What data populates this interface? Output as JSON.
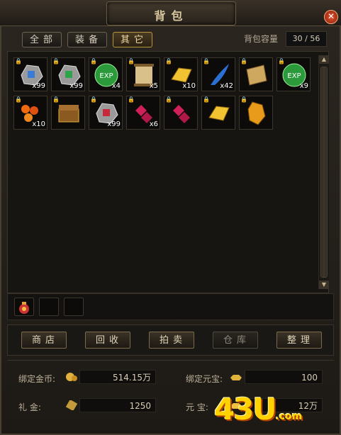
{
  "window": {
    "title": "背包",
    "close_icon": "close-icon"
  },
  "tabs": [
    {
      "label": "全部",
      "active": false
    },
    {
      "label": "装备",
      "active": false
    },
    {
      "label": "其它",
      "active": true
    }
  ],
  "capacity": {
    "label": "背包容量",
    "value": "30 / 56"
  },
  "items": [
    {
      "icon": "blue-rune-stone-icon",
      "count": "x99"
    },
    {
      "icon": "green-rune-stone-icon",
      "count": "x99"
    },
    {
      "icon": "green-exp-orb-icon",
      "count": "x4",
      "text": "EXP"
    },
    {
      "icon": "scroll-icon",
      "count": "x5"
    },
    {
      "icon": "gold-bar-icon",
      "count": "x10"
    },
    {
      "icon": "blue-feather-icon",
      "count": "x42"
    },
    {
      "icon": "parchment-icon",
      "count": ""
    },
    {
      "icon": "green-exp-orb-icon",
      "count": "x9",
      "text": "EXP"
    },
    {
      "icon": "fire-orbs-icon",
      "count": "x10"
    },
    {
      "icon": "treasure-chest-icon",
      "count": ""
    },
    {
      "icon": "red-rune-stone-icon",
      "count": "x99"
    },
    {
      "icon": "red-gems-icon",
      "count": "x6"
    },
    {
      "icon": "red-gems-icon",
      "count": ""
    },
    {
      "icon": "gold-bar-icon",
      "count": ""
    },
    {
      "icon": "amber-crystal-icon",
      "count": ""
    }
  ],
  "quick_slots": [
    "red-pouch-icon",
    "",
    ""
  ],
  "buttons": [
    {
      "label": "商店",
      "enabled": true
    },
    {
      "label": "回收",
      "enabled": true
    },
    {
      "label": "拍卖",
      "enabled": true
    },
    {
      "label": "仓库",
      "enabled": false
    },
    {
      "label": "整理",
      "enabled": true
    }
  ],
  "currency": {
    "bound_gold_label": "绑定金币:",
    "bound_gold_value": "514.15万",
    "bound_ingot_label": "绑定元宝:",
    "bound_ingot_value": "100",
    "gift_gold_label": "礼    金:",
    "gift_gold_value": "1250",
    "ingot_label": "元    宝:",
    "ingot_value": "12万"
  },
  "watermark": "43U.com",
  "colors": {
    "accent": "#b8953f",
    "text": "#cfc3a4",
    "count": "#ffffff"
  }
}
